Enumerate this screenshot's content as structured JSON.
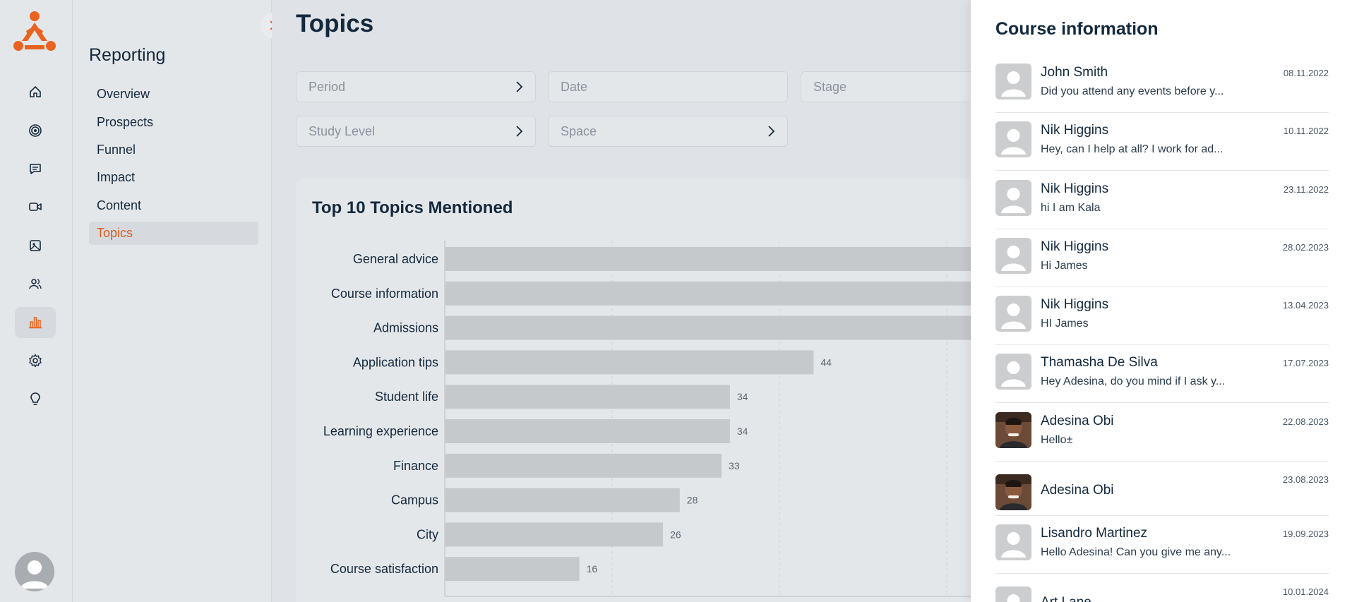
{
  "nav": {
    "items": [
      {
        "name": "home-icon",
        "active": false
      },
      {
        "name": "target-icon",
        "active": false
      },
      {
        "name": "chat-icon",
        "active": false
      },
      {
        "name": "video-icon",
        "active": false
      },
      {
        "name": "image-icon",
        "active": false
      },
      {
        "name": "users-icon",
        "active": false
      },
      {
        "name": "bar-chart-icon",
        "active": true
      },
      {
        "name": "gear-icon",
        "active": false
      },
      {
        "name": "lightbulb-icon",
        "active": false
      }
    ],
    "accent": "#e8631f"
  },
  "submenu": {
    "title": "Reporting",
    "items": [
      "Overview",
      "Prospects",
      "Funnel",
      "Impact",
      "Content",
      "Topics"
    ],
    "active_index": 5
  },
  "main": {
    "title": "Topics",
    "filters": [
      {
        "placeholder": "Period",
        "has_chevron": true
      },
      {
        "placeholder": "Date",
        "has_chevron": false
      },
      {
        "placeholder": "Stage",
        "has_chevron": false
      },
      {
        "placeholder": "Study Level",
        "has_chevron": true
      },
      {
        "placeholder": "Space",
        "has_chevron": true
      }
    ],
    "card_title": "Top 10 Topics Mentioned"
  },
  "chart_data": {
    "type": "bar",
    "orientation": "horizontal",
    "title": "Top 10 Topics Mentioned",
    "categories": [
      "General advice",
      "Course information",
      "Admissions",
      "Application tips",
      "Student life",
      "Learning experience",
      "Finance",
      "Campus",
      "City",
      "Course satisfaction"
    ],
    "values": [
      null,
      null,
      null,
      44,
      34,
      34,
      33,
      28,
      26,
      16
    ],
    "value_labels": [
      "",
      "",
      "",
      "44",
      "34",
      "34",
      "33",
      "28",
      "26",
      "16"
    ],
    "x_ticks": [
      "0",
      "20",
      "40",
      "60"
    ],
    "xlim": [
      0,
      80
    ],
    "grid": true,
    "bar_color": "#c6c9cc"
  },
  "drawer": {
    "title": "Course information",
    "messages": [
      {
        "name": "John Smith",
        "preview": "Did you attend any events before y...",
        "date": "08.11.2022",
        "photo": false
      },
      {
        "name": "Nik Higgins",
        "preview": "Hey, can I help at all? I work for ad...",
        "date": "10.11.2022",
        "photo": false
      },
      {
        "name": "Nik Higgins",
        "preview": "hi I am Kala",
        "date": "23.11.2022",
        "photo": false
      },
      {
        "name": "Nik Higgins",
        "preview": "Hi James",
        "date": "28.02.2023",
        "photo": false
      },
      {
        "name": "Nik Higgins",
        "preview": "HI James",
        "date": "13.04.2023",
        "photo": false
      },
      {
        "name": "Thamasha De Silva",
        "preview": "Hey Adesina, do you mind if I ask y...",
        "date": "17.07.2023",
        "photo": false
      },
      {
        "name": "Adesina Obi",
        "preview": "Hello±",
        "date": "22.08.2023",
        "photo": true
      },
      {
        "name": "Adesina Obi",
        "preview": "",
        "date": "23.08.2023",
        "photo": true
      },
      {
        "name": "Lisandro Martinez",
        "preview": "Hello Adesina! Can you give me any...",
        "date": "19.09.2023",
        "photo": false
      },
      {
        "name": "Art Lane",
        "preview": "",
        "date": "10.01.2024",
        "photo": false
      }
    ]
  }
}
